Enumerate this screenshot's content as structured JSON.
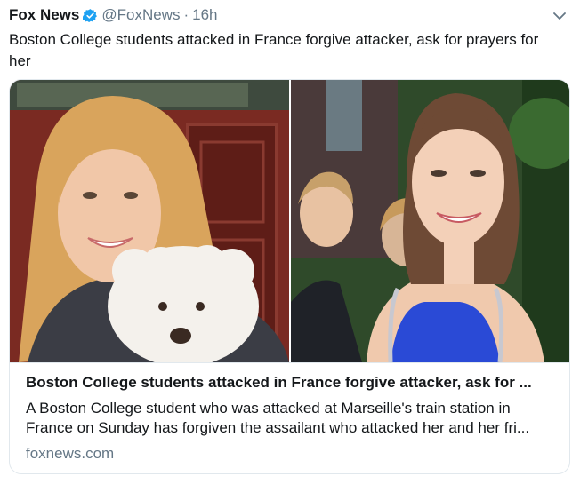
{
  "tweet": {
    "author_name": "Fox News",
    "handle": "@FoxNews",
    "separator": "·",
    "time": "16h",
    "text": "Boston College students attacked in France forgive attacker, ask for prayers for her"
  },
  "card": {
    "title": "Boston College students attacked in France forgive attacker, ask for ...",
    "description": "A Boston College student who was attacked at Marseille's train station in France on Sunday has forgiven the assailant who attacked her and her fri...",
    "domain": "foxnews.com",
    "image_left_icon": "photo-woman-with-dog",
    "image_right_icon": "photo-woman-smiling"
  },
  "icons": {
    "verified": "verified-badge-icon",
    "menu": "chevron-down-icon"
  },
  "colors": {
    "verified_blue": "#1da1f2",
    "secondary_text": "#657786",
    "primary_text": "#14171a",
    "border": "#e1e8ed"
  }
}
